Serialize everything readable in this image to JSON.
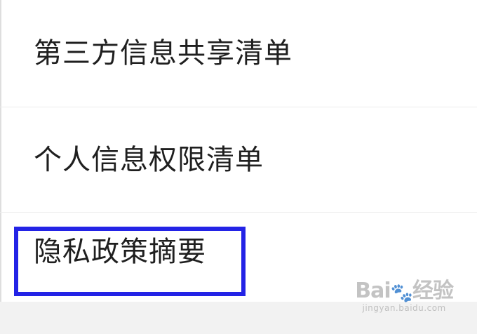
{
  "menu": {
    "items": [
      {
        "label": "第三方信息共享清单"
      },
      {
        "label": "个人信息权限清单"
      },
      {
        "label": "隐私政策摘要"
      }
    ]
  },
  "watermark": {
    "brand": "Bai",
    "paw_glyph": "🐾",
    "brand_tail": "经验",
    "domain": "jingyan.baidu.com"
  },
  "colors": {
    "highlight": "#2323e6",
    "text": "#1f1f1f",
    "divider": "#ececec",
    "bottom_bar": "#f2f2f2"
  }
}
